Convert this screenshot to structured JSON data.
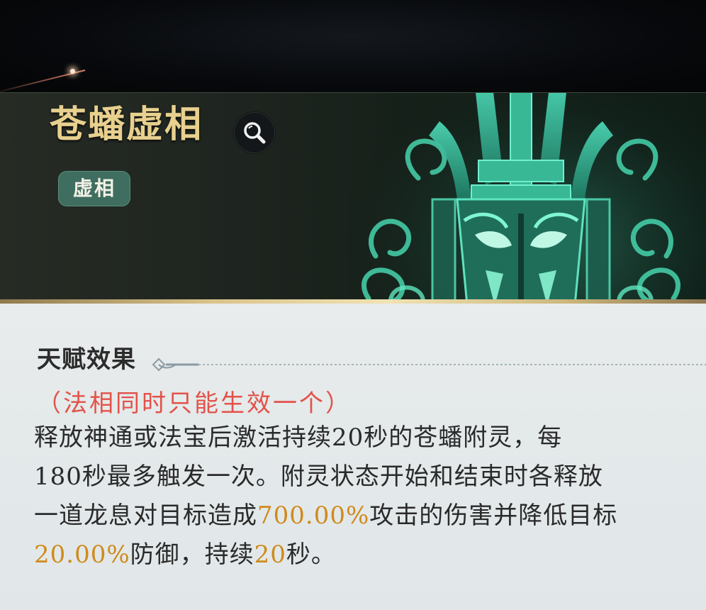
{
  "item": {
    "name": "苍蟠虚相",
    "tag": "虚相"
  },
  "talent": {
    "section_title": "天赋效果",
    "note": "（法相同时只能生效一个）",
    "lines": [
      [
        {
          "text": "释放神通或法宝后激活持续20秒的苍蟠附灵，每",
          "hl": false
        }
      ],
      [
        {
          "text": "180秒最多触发一次。附灵状态开始和结束时各释放",
          "hl": false
        }
      ],
      [
        {
          "text": "一道龙息对目标造成",
          "hl": false
        },
        {
          "text": "700.00%",
          "hl": true
        },
        {
          "text": "攻击的伤害并降低目标",
          "hl": false
        }
      ],
      [
        {
          "text": "20.00%",
          "hl": true
        },
        {
          "text": "防御，持续",
          "hl": false
        },
        {
          "text": "20",
          "hl": true
        },
        {
          "text": "秒。",
          "hl": false
        }
      ]
    ]
  },
  "icons": {
    "search": "magnifier-icon",
    "beast": "jade-beast-mask-art",
    "divider": "ornament-divider"
  },
  "colors": {
    "title_gold": "#e8d08e",
    "tag_green": "#3f6e60",
    "note_red": "#e3524a",
    "highlight_orange": "#d08a1c",
    "jade": "#3fd6b0"
  }
}
